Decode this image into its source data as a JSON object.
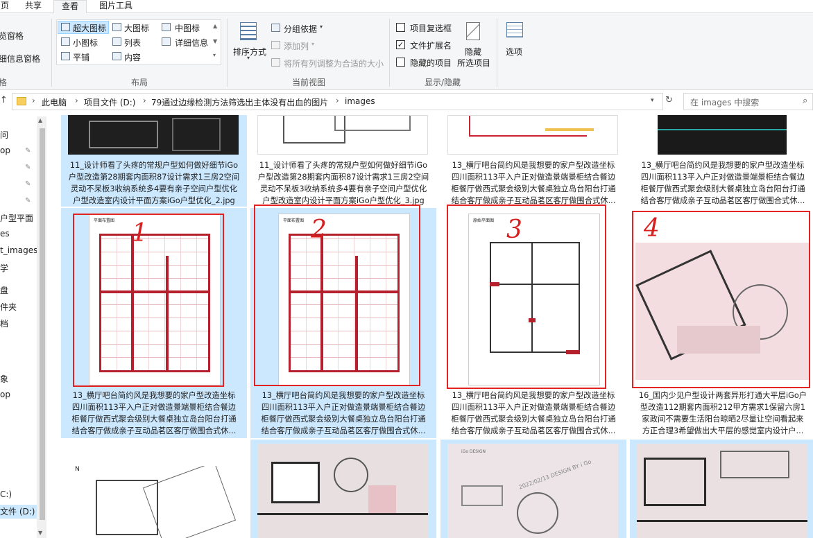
{
  "ribbon_tabs": [
    "页",
    "共享",
    "查看",
    "图片工具"
  ],
  "pane": {
    "preview": "览窗格",
    "details": "细信息窗格",
    "group_label": "格"
  },
  "layout": {
    "items": [
      "超大图标",
      "大图标",
      "中图标",
      "小图标",
      "列表",
      "详细信息",
      "平铺",
      "内容"
    ],
    "group_label": "布局"
  },
  "current_view": {
    "sort": "排序方式",
    "group_by": "分组依据",
    "add_column": "添加列",
    "fit_columns": "将所有列调整为合适的大小",
    "group_label": "当前视图"
  },
  "show_hide": {
    "item_checkboxes": "项目复选框",
    "file_ext": "文件扩展名",
    "hidden_items": "隐藏的项目",
    "hide_selected_1": "隐藏",
    "hide_selected_2": "所选项目",
    "options": "选项",
    "group_label": "显示/隐藏",
    "checked": {
      "item_checkboxes": false,
      "file_ext": true,
      "hidden_items": false
    }
  },
  "address": {
    "parts": [
      "此电脑",
      "项目文件 (D:)",
      "79通过边缘检测方法筛选出主体没有出血的图片",
      "images"
    ],
    "search_placeholder": "在 images 中搜索"
  },
  "sidebar": {
    "items": [
      "问",
      "op",
      "",
      "",
      "",
      "户型平面",
      "es",
      "t_images",
      "学",
      "盘",
      "件夹",
      "档",
      "",
      "象",
      "op",
      "C:)",
      "文件 (D:)"
    ]
  },
  "files": [
    {
      "lines": [
        "11_设计师看了头疼的常规户型如何做好细节iGo",
        "户型改造第28期套内面积87设计需求1三房2空间",
        "灵动不呆板3收纳系统多4要有亲子空间户型优化",
        "户型改造室内设计平面方案iGo户型优化_2.jpg"
      ]
    },
    {
      "lines": [
        "11_设计师看了头疼的常规户型如何做好细节iGo",
        "户型改造第28期套内面积87设计需求1三房2空间",
        "灵动不呆板3收纳系统多4要有亲子空间户型优化",
        "户型改造室内设计平面方案iGo户型优化_3.jpg"
      ]
    },
    {
      "lines": [
        "13_横厅吧台简约风是我想要的家户型改造坐标",
        "四川面积113平入户正对做造景端景柜结合餐边",
        "柜餐厅做西式聚会级别大餐桌独立岛台阳台打通",
        "结合客厅做成亲子互动品茗区客厅做围合式休..."
      ]
    },
    {
      "lines": [
        "13_横厅吧台简约风是我想要的家户型改造坐标",
        "四川面积113平入户正对做造景端景柜结合餐边",
        "柜餐厅做西式聚会级别大餐桌独立岛台阳台打通",
        "结合客厅做成亲子互动品茗区客厅做围合式休..."
      ]
    },
    {
      "lines": [
        "13_横厅吧台简约风是我想要的家户型改造坐标",
        "四川面积113平入户正对做造景端景柜结合餐边",
        "柜餐厅做西式聚会级别大餐桌独立岛台阳台打通",
        "结合客厅做成亲子互动品茗区客厅做围合式休..."
      ]
    },
    {
      "lines": [
        "13_横厅吧台简约风是我想要的家户型改造坐标",
        "四川面积113平入户正对做造景端景柜结合餐边",
        "柜餐厅做西式聚会级别大餐桌独立岛台阳台打通",
        "结合客厅做成亲子互动品茗区客厅做围合式休..."
      ]
    },
    {
      "lines": [
        "13_横厅吧台简约风是我想要的家户型改造坐标",
        "四川面积113平入户正对做造景端景柜结合餐边",
        "柜餐厅做西式聚会级别大餐桌独立岛台阳台打通",
        "结合客厅做成亲子互动品茗区客厅做围合式休..."
      ]
    },
    {
      "lines": [
        "16_国内少见户型设计两套异形打通大平层iGo户",
        "型改造112期套内面积212甲方需求1保留六房1",
        "家政间不需要生活阳台晾晒2尽量让空间看起来",
        "方正合理3希望做出大平层的感觉室内设计户..."
      ]
    }
  ],
  "thumb_text": {
    "plan1": "平面布置图",
    "plan2": "平面布置图",
    "plan3": "原始平面图",
    "design": "2022/02/13 DESIGN BY i Go",
    "brand": "iGo DESIGN"
  },
  "marks": [
    "1",
    "2",
    "3",
    "4"
  ]
}
